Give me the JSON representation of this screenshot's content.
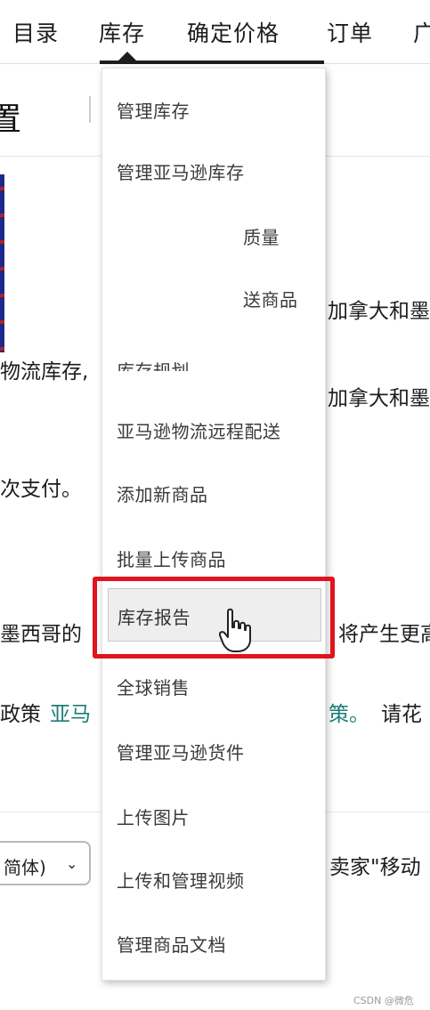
{
  "nav": {
    "items": [
      {
        "label": "目录",
        "key": "catalog"
      },
      {
        "label": "库存",
        "key": "inventory"
      },
      {
        "label": "确定价格",
        "key": "pricing"
      },
      {
        "label": "订单",
        "key": "orders"
      },
      {
        "label": "广",
        "key": "advertising"
      }
    ]
  },
  "page": {
    "title_fragment": "置",
    "lines": [
      "加拿大和墨",
      "物流库存,",
      "加拿大和墨",
      "次支付。",
      "墨西哥的",
      "将产生更高",
      "政策",
      "亚马",
      "策。",
      "请花",
      "卖家\"移动"
    ],
    "language_select": "简体)",
    "language_chevron": "⌄"
  },
  "dropdown": {
    "items": [
      "管理库存",
      "管理亚马逊库存",
      "质量",
      "送商品",
      "库存规划",
      "亚马逊物流远程配送",
      "添加新商品",
      "批量上传商品",
      "库存报告",
      "全球销售",
      "管理亚马逊货件",
      "上传图片",
      "上传和管理视频",
      "管理商品文档"
    ],
    "highlighted": "库存报告"
  },
  "watermark": "CSDN @微危",
  "colors": {
    "highlight_border": "#e0141e",
    "link": "#1a7f7a",
    "nav_active": "#1d1d1d"
  }
}
